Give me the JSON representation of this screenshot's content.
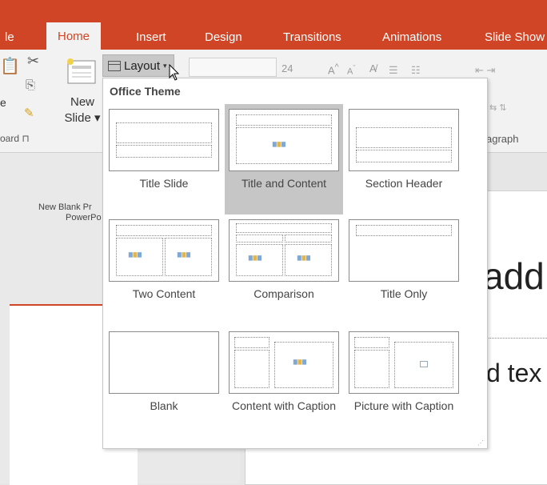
{
  "tabs": [
    {
      "label": "le",
      "active": false
    },
    {
      "label": "Home",
      "active": true
    },
    {
      "label": "Insert",
      "active": false
    },
    {
      "label": "Design",
      "active": false
    },
    {
      "label": "Transitions",
      "active": false
    },
    {
      "label": "Animations",
      "active": false
    },
    {
      "label": "Slide Show",
      "active": false
    }
  ],
  "ribbon": {
    "paste_label": "e",
    "clipboard_label": "oard ⊓",
    "new_slide_label": "New",
    "new_slide_label2": "Slide ▾",
    "layout_label": "Layout",
    "font_size": "24",
    "paragraph_label": "agraph"
  },
  "layout_menu": {
    "title": "Office Theme",
    "items": [
      {
        "label": "Title Slide",
        "selected": false
      },
      {
        "label": "Title and Content",
        "selected": true
      },
      {
        "label": "Section Header",
        "selected": false
      },
      {
        "label": "Two Content",
        "selected": false
      },
      {
        "label": "Comparison",
        "selected": false
      },
      {
        "label": "Title Only",
        "selected": false
      },
      {
        "label": "Blank",
        "selected": false
      },
      {
        "label": "Content with Caption",
        "selected": false
      },
      {
        "label": "Picture with Caption",
        "selected": false
      }
    ]
  },
  "left_pane": {
    "caption_line1": "New Blank Pr",
    "caption_line2": "PowerPo"
  },
  "slide": {
    "title_fragment": "add",
    "text_fragment": "d tex"
  },
  "colors": {
    "tab_bar": "#d04525",
    "ribbon": "#f2f2f2",
    "selection": "#c6c6c6"
  }
}
